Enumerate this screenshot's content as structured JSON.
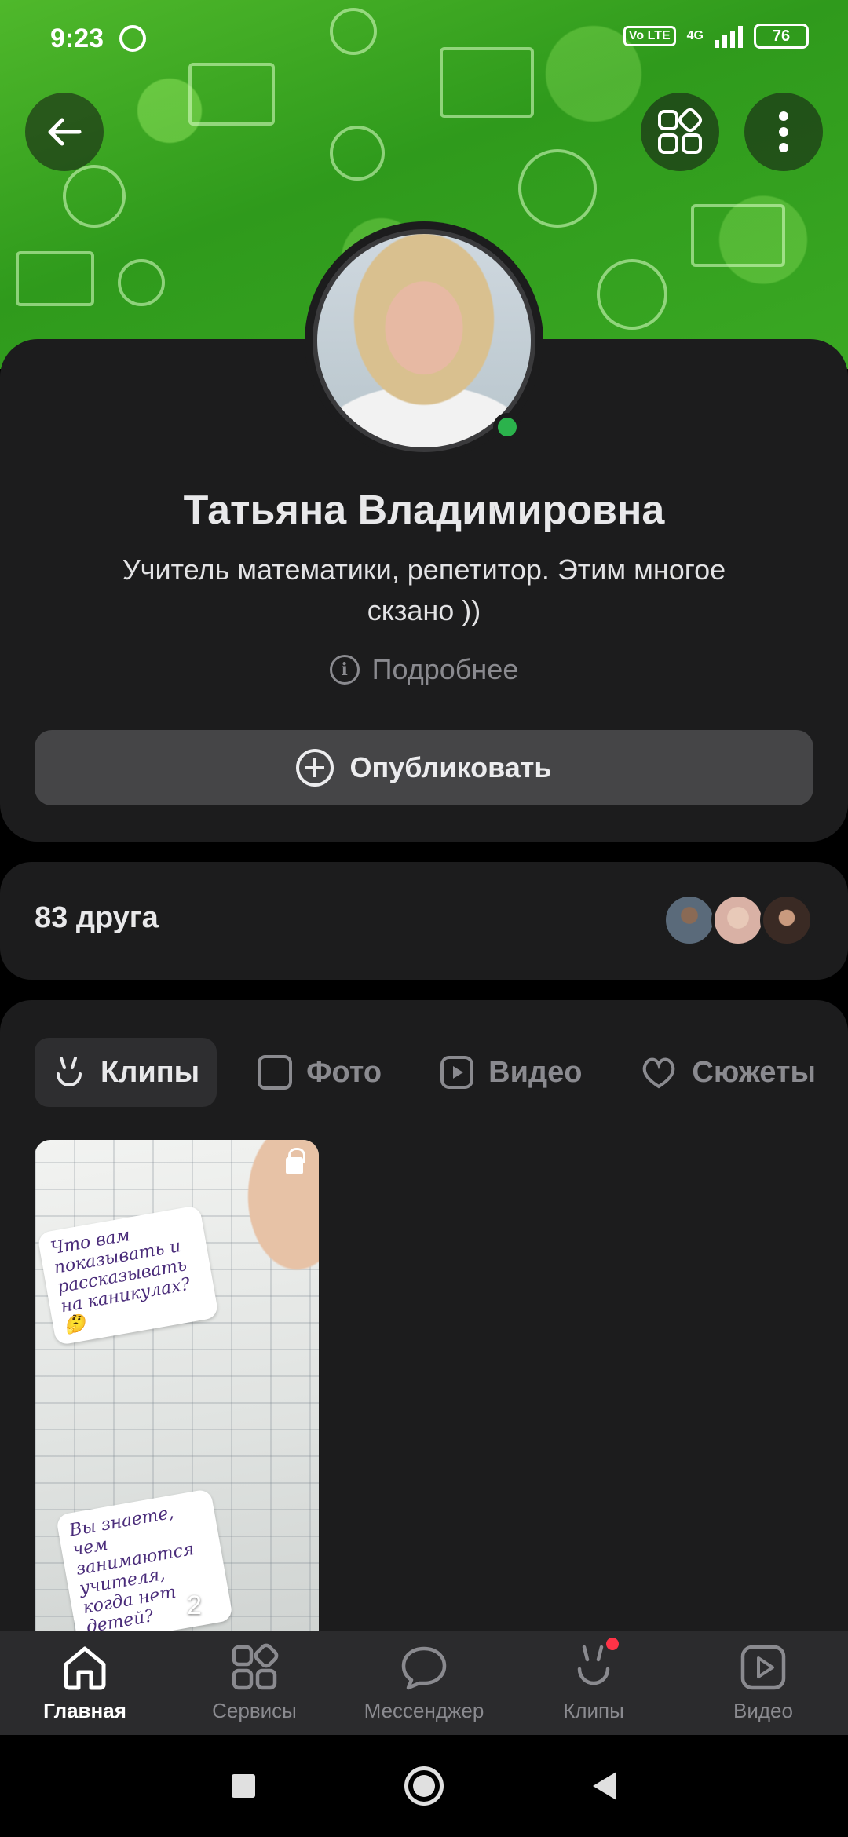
{
  "status_bar": {
    "time": "9:23",
    "network": "4G",
    "volte": "Vo LTE",
    "battery": "76"
  },
  "profile": {
    "name": "Татьяна Владимировна",
    "status": "Учитель математики, репетитор. Этим многое скзано ))",
    "more_info": "Подробнее",
    "publish_label": "Опубликовать",
    "online": true,
    "accent_online": "#2bb24c"
  },
  "friends": {
    "count_label": "83 друга",
    "avatars": [
      "friend-avatar-1",
      "friend-avatar-2",
      "friend-avatar-3"
    ]
  },
  "tabs": [
    {
      "label": "Клипы",
      "icon": "clips-icon",
      "active": true
    },
    {
      "label": "Фото",
      "icon": "photo-icon",
      "active": false
    },
    {
      "label": "Видео",
      "icon": "video-icon",
      "active": false
    },
    {
      "label": "Сюжеты",
      "icon": "stories-icon",
      "active": false
    }
  ],
  "clip": {
    "views": "2",
    "sticker_top": "Что вам показывать и рассказывать на каникулах? 🤔",
    "sticker_bottom": "Вы знаете, чем занимаются учителя, когда нет детей?"
  },
  "bottom_nav": [
    {
      "label": "Главная",
      "icon": "home-icon",
      "active": true
    },
    {
      "label": "Сервисы",
      "icon": "services-icon",
      "active": false
    },
    {
      "label": "Мессенджер",
      "icon": "messenger-icon",
      "active": false
    },
    {
      "label": "Клипы",
      "icon": "clips-icon",
      "active": false,
      "badge": true
    },
    {
      "label": "Видео",
      "icon": "video-icon",
      "active": false
    }
  ],
  "colors": {
    "background": "#000000",
    "card": "#1c1c1d",
    "cover_green": "#3aa823",
    "badge_red": "#ff3347"
  }
}
